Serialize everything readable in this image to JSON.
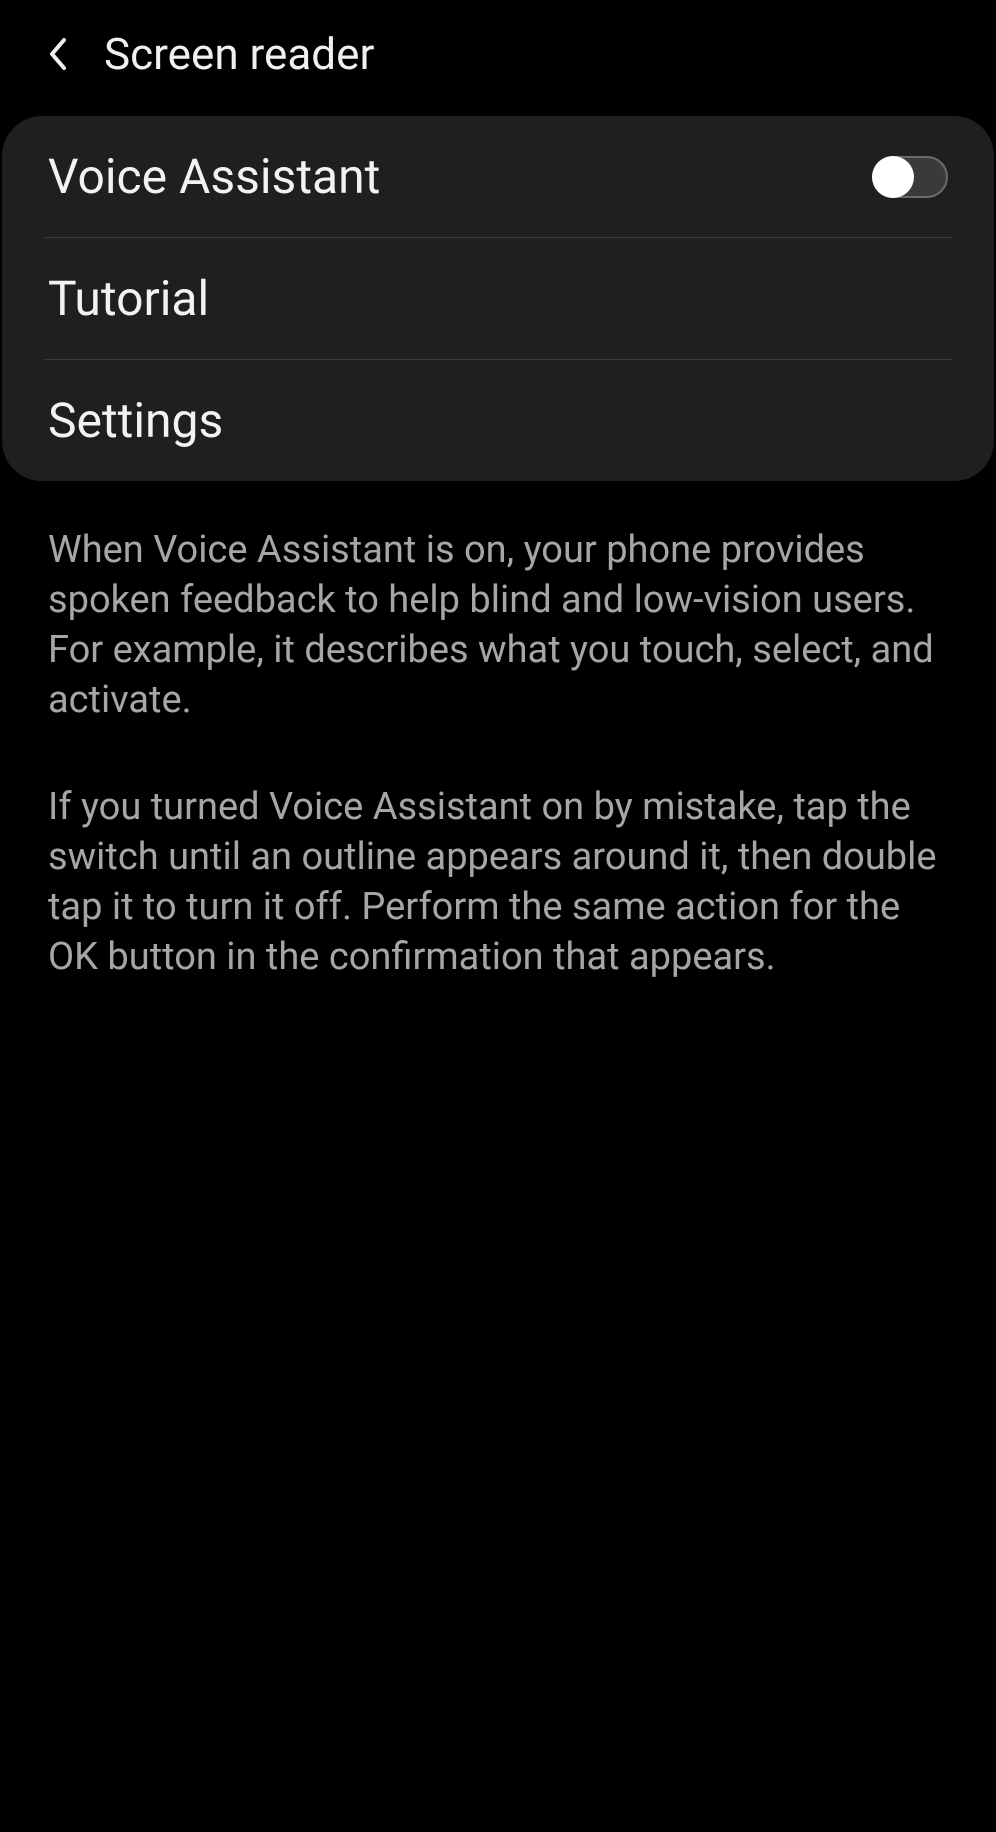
{
  "header": {
    "title": "Screen reader"
  },
  "items": {
    "voice_assistant": {
      "label": "Voice Assistant",
      "toggle_on": false
    },
    "tutorial": {
      "label": "Tutorial"
    },
    "settings": {
      "label": "Settings"
    }
  },
  "description": {
    "para1": "When Voice Assistant is on, your phone provides spoken feedback to help blind and low-vision users. For example, it describes what you touch, select, and activate.",
    "para2": "If you turned Voice Assistant on by mistake, tap the switch until an outline appears around it, then double tap it to turn it off. Perform the same action for the OK button in the confirmation that appears."
  }
}
